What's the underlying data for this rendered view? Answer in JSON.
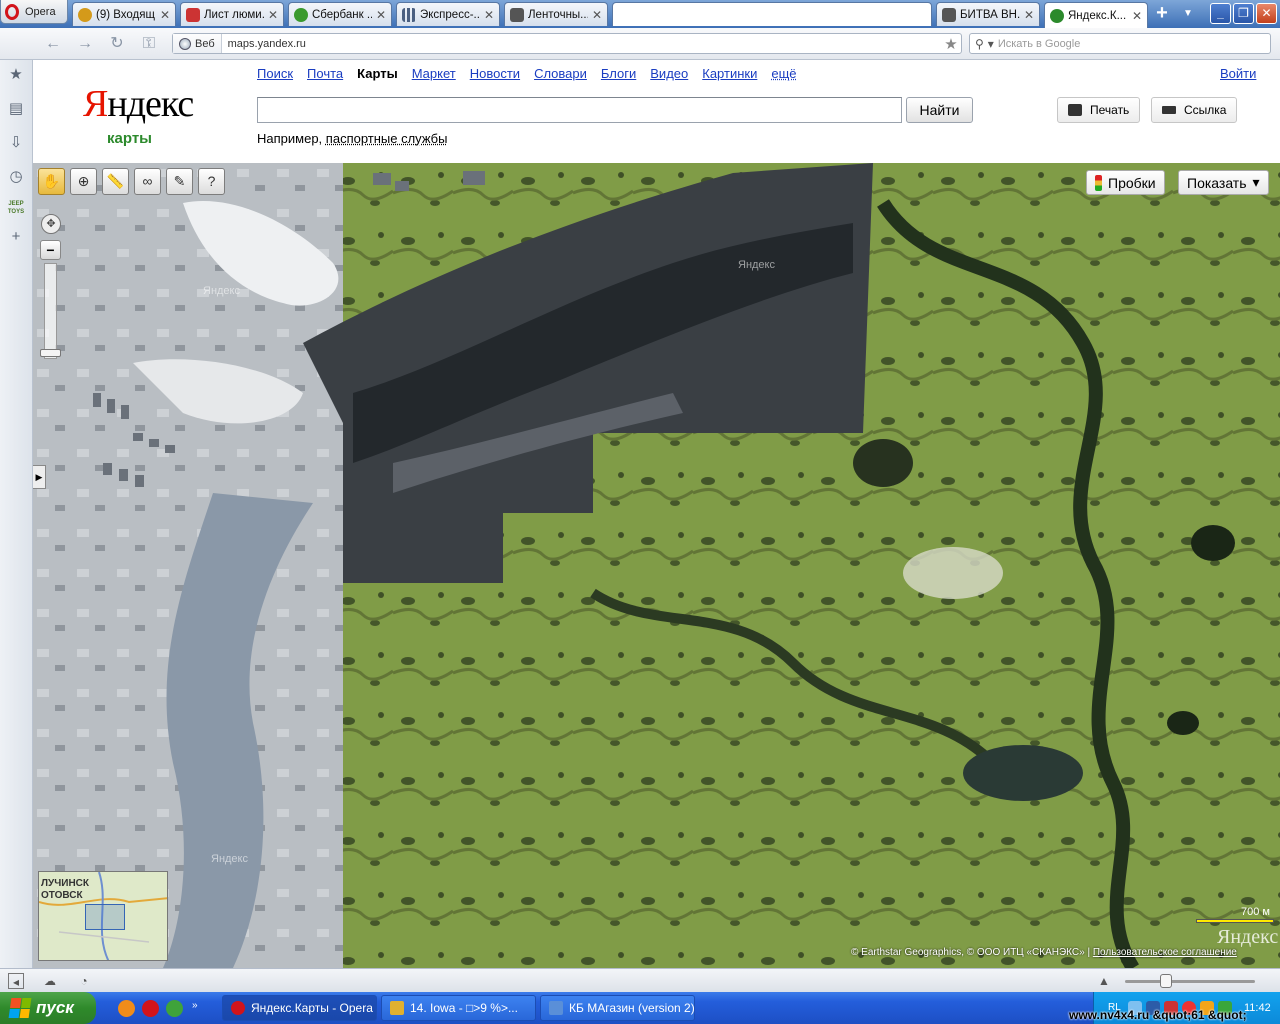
{
  "browser": {
    "menu_label": "Opera",
    "tabs": [
      {
        "label": "(9) Входящ...",
        "color": "#d49a1a"
      },
      {
        "label": "Лист люми...",
        "color": "#c33"
      },
      {
        "label": "Сбербанк ...",
        "color": "#3a9a2e"
      },
      {
        "label": "Экспресс-...",
        "color": "#4a5f80"
      },
      {
        "label": "Ленточны...",
        "color": "#555"
      },
      {
        "label": "",
        "color": "#ffffff"
      },
      {
        "label": "БИТВА ВН...",
        "color": "#555"
      },
      {
        "label": "Яндекс.К...",
        "color": "#2c8a2c"
      }
    ],
    "address": {
      "type_label": "Веб",
      "url": "maps.yandex.ru"
    },
    "search_placeholder": "Искать в Google"
  },
  "yandex": {
    "logo_first": "Я",
    "logo_rest": "ндекс",
    "logo_sub": "карты",
    "nav": [
      "Поиск",
      "Почта",
      "Карты",
      "Маркет",
      "Новости",
      "Словари",
      "Блоги",
      "Видео",
      "Картинки",
      "ещё"
    ],
    "nav_current": "Карты",
    "login": "Войти",
    "search_value": "",
    "find_button": "Найти",
    "example_prefix": "Например,",
    "example_link": "паспортные службы",
    "print_button": "Печать",
    "link_button": "Ссылка"
  },
  "map": {
    "traffic_button": "Пробки",
    "show_button": "Показать",
    "watermark": "Яндекс",
    "minimap_labels": [
      "ЛУЧИНСК",
      "ОТОВСК"
    ],
    "scale_label": "700 м",
    "logo": "Яндекс",
    "copyright": "© Earthstar Geographics, © ООО ИТЦ «СКАНЭКС»",
    "agreement_link": "Пользовательское соглашение"
  },
  "taskbar": {
    "start_label": "пуск",
    "tasks": [
      {
        "label": "Яндекс.Карты - Opera",
        "color": "#d2141b"
      },
      {
        "label": "14. Iowa - □>9 %>...",
        "color": "#e0b030"
      },
      {
        "label": "КБ МАгазин (version 2)",
        "color": "#5a8fd8"
      }
    ],
    "tray_lang": "RL",
    "clock": "11:42"
  },
  "overlay_watermark": "www.nv4x4.ru &quot;61 &quot;"
}
